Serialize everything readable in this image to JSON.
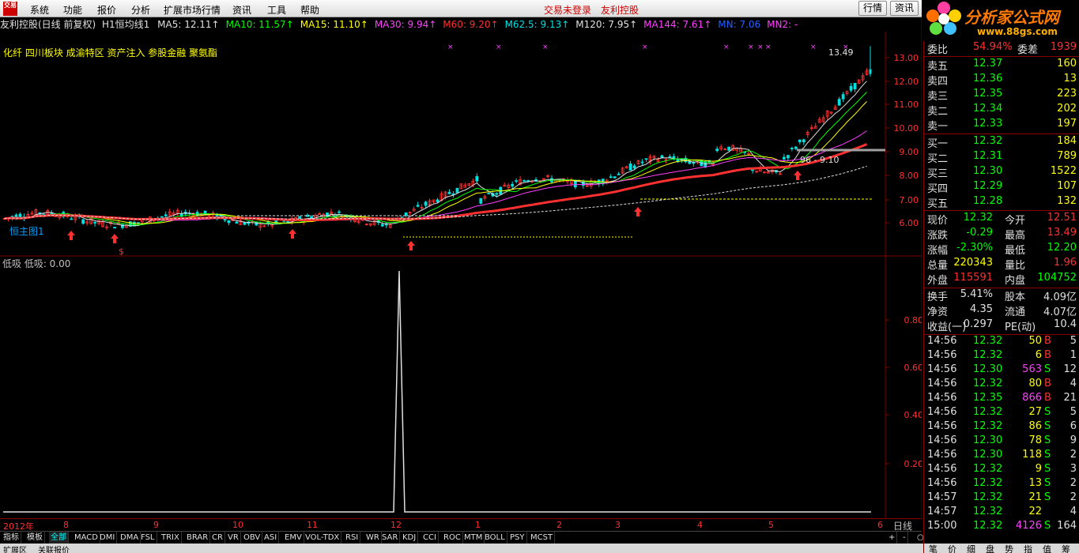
{
  "app": {
    "logo": "交易",
    "status": "交易未登录",
    "broker": "友利控股",
    "btn_quote": "行情",
    "btn_info": "资讯"
  },
  "menu": [
    "系统",
    "功能",
    "报价",
    "分析",
    "扩展市场行情",
    "资讯",
    "工具",
    "帮助"
  ],
  "brand": {
    "name": "分析家公式网",
    "url": "www.88gs.com"
  },
  "title": {
    "stock": "友利控股(日线 前复权)",
    "formula": "H1恒均线1",
    "ma": [
      {
        "label": "MA5: 12.11↑",
        "color": "#e0e0e0"
      },
      {
        "label": "MA10: 11.57↑",
        "color": "#00ff00"
      },
      {
        "label": "MA15: 11.10↑",
        "color": "#ffff00"
      },
      {
        "label": "MA30: 9.94↑",
        "color": "#ff40ff"
      },
      {
        "label": "M60: 9.20↑",
        "color": "#ff3030"
      },
      {
        "label": "M62.5: 9.13↑",
        "color": "#00e0e0"
      },
      {
        "label": "M120: 7.95↑",
        "color": "#e0e0e0"
      },
      {
        "label": "MA144: 7.61↑",
        "color": "#ff40ff"
      },
      {
        "label": "MN: 7.06",
        "color": "#2060ff"
      },
      {
        "label": "MN2: -",
        "color": "#ff40ff"
      }
    ]
  },
  "tags": "化纤 四川板块 成渝特区 资产注入 参股金融 聚氨酯",
  "main_chart": {
    "price_axis": [
      "13.00",
      "12.00",
      "11.00",
      "10.00",
      "9.00",
      "8.00",
      "7.00",
      "6.00"
    ],
    "high_label": "13.49",
    "range_label": "96 - 9.10",
    "left_label": "恒主图1",
    "mark": "$"
  },
  "sub_chart": {
    "title": "低吸 低吸: 0.00",
    "axis": [
      "0.80",
      "0.60",
      "0.40",
      "0.20"
    ]
  },
  "dates": [
    "2012年",
    "8",
    "9",
    "10",
    "11",
    "12",
    "1",
    "2",
    "3",
    "4",
    "5",
    "6"
  ],
  "period": "日线",
  "tabs": [
    "指标",
    "模板",
    "全部",
    "MACD",
    "DMI",
    "DMA",
    "FSL",
    "TRIX",
    "BRAR",
    "CR",
    "VR",
    "OBV",
    "ASI",
    "EMV",
    "VOL-TDX",
    "RSI",
    "WR",
    "SAR",
    "KDJ",
    "CCI",
    "ROC",
    "MTM",
    "BOLL",
    "PSY",
    "MCST"
  ],
  "tab_controls": [
    "+",
    "-",
    "○"
  ],
  "status": [
    "扩展区",
    "关联报价"
  ],
  "quote": {
    "weibi": {
      "label": "委比",
      "value": "54.94%",
      "label2": "委差",
      "value2": "1939"
    },
    "asks": [
      {
        "label": "卖五",
        "price": "12.37",
        "vol": "160"
      },
      {
        "label": "卖四",
        "price": "12.36",
        "vol": "13"
      },
      {
        "label": "卖三",
        "price": "12.35",
        "vol": "223"
      },
      {
        "label": "卖二",
        "price": "12.34",
        "vol": "202"
      },
      {
        "label": "卖一",
        "price": "12.33",
        "vol": "197"
      }
    ],
    "bids": [
      {
        "label": "买一",
        "price": "12.32",
        "vol": "184"
      },
      {
        "label": "买二",
        "price": "12.31",
        "vol": "789"
      },
      {
        "label": "买三",
        "price": "12.30",
        "vol": "1522"
      },
      {
        "label": "买四",
        "price": "12.29",
        "vol": "107"
      },
      {
        "label": "买五",
        "price": "12.28",
        "vol": "132"
      }
    ],
    "stats": [
      {
        "l1": "现价",
        "v1": "12.32",
        "l2": "今开",
        "v2": "12.51"
      },
      {
        "l1": "涨跌",
        "v1": "-0.29",
        "l2": "最高",
        "v2": "13.49"
      },
      {
        "l1": "涨幅",
        "v1": "-2.30%",
        "l2": "最低",
        "v2": "12.20"
      },
      {
        "l1": "总量",
        "v1": "220343",
        "l2": "量比",
        "v2": "1.96"
      },
      {
        "l1": "外盘",
        "v1": "115591",
        "l2": "内盘",
        "v2": "104752"
      }
    ],
    "fund": [
      {
        "l1": "换手",
        "v1": "5.41%",
        "l2": "股本",
        "v2": "4.09亿"
      },
      {
        "l1": "净资",
        "v1": "4.35",
        "l2": "流通",
        "v2": "4.07亿"
      },
      {
        "l1": "收益(一)",
        "v1": "0.297",
        "l2": "PE(动)",
        "v2": "10.4"
      }
    ],
    "ticks": [
      {
        "t": "14:56",
        "p": "12.32",
        "v": "50",
        "s": "B",
        "n": "5"
      },
      {
        "t": "14:56",
        "p": "12.32",
        "v": "6",
        "s": "B",
        "n": "1"
      },
      {
        "t": "14:56",
        "p": "12.30",
        "v": "563",
        "s": "S",
        "n": "12"
      },
      {
        "t": "14:56",
        "p": "12.32",
        "v": "80",
        "s": "B",
        "n": "4"
      },
      {
        "t": "14:56",
        "p": "12.35",
        "v": "866",
        "s": "B",
        "n": "21"
      },
      {
        "t": "14:56",
        "p": "12.32",
        "v": "27",
        "s": "S",
        "n": "5"
      },
      {
        "t": "14:56",
        "p": "12.32",
        "v": "86",
        "s": "S",
        "n": "6"
      },
      {
        "t": "14:56",
        "p": "12.30",
        "v": "78",
        "s": "S",
        "n": "9"
      },
      {
        "t": "14:56",
        "p": "12.30",
        "v": "118",
        "s": "S",
        "n": "2"
      },
      {
        "t": "14:56",
        "p": "12.32",
        "v": "9",
        "s": "S",
        "n": "3"
      },
      {
        "t": "14:56",
        "p": "12.32",
        "v": "13",
        "s": "S",
        "n": "2"
      },
      {
        "t": "14:57",
        "p": "12.32",
        "v": "21",
        "s": "S",
        "n": "2"
      },
      {
        "t": "14:57",
        "p": "12.32",
        "v": "22",
        "s": "",
        "n": "4"
      },
      {
        "t": "15:00",
        "p": "12.32",
        "v": "4126",
        "s": "S",
        "n": "164"
      }
    ],
    "bottom_tabs": [
      "笔",
      "价",
      "细",
      "盘",
      "势",
      "指",
      "值",
      "筹"
    ]
  },
  "colors": {
    "up": "#ff3030",
    "down": "#00e0e0",
    "axis": "#800000",
    "flat": "#e0e0e0"
  }
}
